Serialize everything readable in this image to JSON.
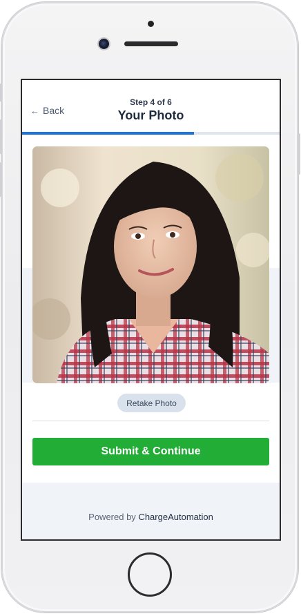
{
  "header": {
    "back_label": "Back",
    "back_icon": "arrow-left-icon",
    "step_text": "Step 4 of 6",
    "title": "Your Photo"
  },
  "progress": {
    "current_step": 4,
    "total_steps": 6,
    "fraction": 0.667,
    "fill_color": "#1b74d8",
    "track_color": "#dfe5ee"
  },
  "photo": {
    "subject": "portrait-photo"
  },
  "actions": {
    "retake_label": "Retake Photo",
    "submit_label": "Submit & Continue",
    "submit_color": "#22ad36"
  },
  "footer": {
    "powered_prefix": "Powered by",
    "brand": "ChargeAutomation"
  }
}
